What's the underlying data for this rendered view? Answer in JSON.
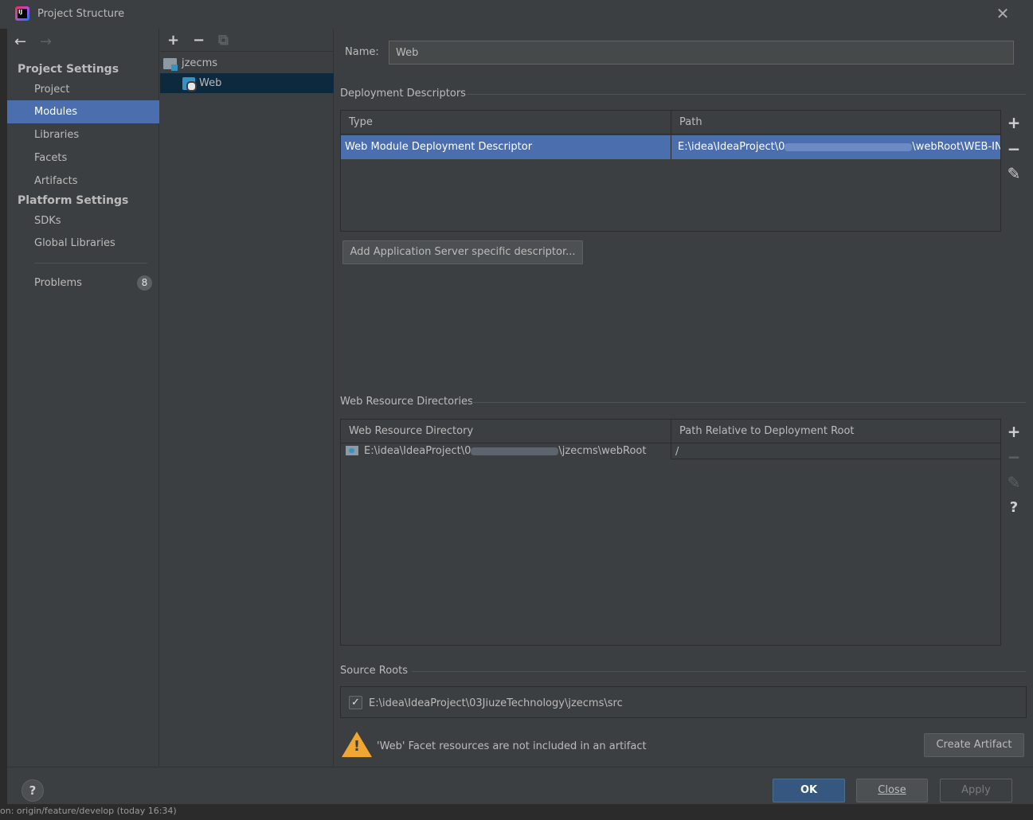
{
  "window": {
    "title": "Project Structure",
    "app_icon_text": "IJ",
    "close_glyph": "✕"
  },
  "background": {
    "status_text": "on: origin/feature/develop (today 16:34)"
  },
  "sidebar": {
    "back_glyph": "←",
    "forward_glyph": "→",
    "project_settings_header": "Project Settings",
    "project_items": [
      "Project",
      "Modules",
      "Libraries",
      "Facets",
      "Artifacts"
    ],
    "selected_item": "Modules",
    "platform_settings_header": "Platform Settings",
    "platform_items": [
      "SDKs",
      "Global Libraries"
    ],
    "problems_label": "Problems",
    "problems_count": "8"
  },
  "tree": {
    "toolbar": {
      "add": "+",
      "remove": "−",
      "copy": "⧉"
    },
    "root": "jzecms",
    "child": "Web"
  },
  "facet": {
    "name_label": "Name:",
    "name_value": "Web",
    "deployment_descriptors": {
      "group_label": "Deployment Descriptors",
      "columns": [
        "Type",
        "Path"
      ],
      "rows": [
        {
          "type": "Web Module Deployment Descriptor",
          "path_prefix": "E:\\idea\\IdeaProject\\0",
          "path_suffix": "\\webRoot\\WEB-INF\\"
        }
      ],
      "add_server_button": "Add Application Server specific descriptor..."
    },
    "web_resource_directories": {
      "group_label": "Web Resource Directories",
      "columns": [
        "Web Resource Directory",
        "Path Relative to Deployment Root"
      ],
      "rows": [
        {
          "directory_prefix": "E:\\idea\\IdeaProject\\0",
          "directory_suffix": "\\jzecms\\webRoot",
          "relative_path": "/"
        }
      ]
    },
    "source_roots": {
      "group_label": "Source Roots",
      "checked": true,
      "check_glyph": "✓",
      "path": "E:\\idea\\IdeaProject\\03JiuzeTechnology\\jzecms\\src"
    },
    "warning": {
      "text": "'Web' Facet resources are not included in an artifact",
      "button": "Create Artifact"
    }
  },
  "side_tools": {
    "add": "+",
    "remove": "−",
    "edit": "✎",
    "help": "?"
  },
  "footer": {
    "help_glyph": "?",
    "ok": "OK",
    "close": "Close",
    "apply": "Apply"
  },
  "colors": {
    "background": "#3c3f41",
    "selection": "#4b6eaf",
    "tree_selection": "#0d293e",
    "primary_button": "#365880",
    "warning": "#f0a732"
  }
}
